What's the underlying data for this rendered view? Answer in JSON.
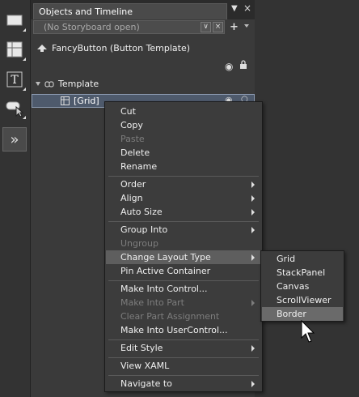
{
  "panel": {
    "tab_title": "Objects and Timeline",
    "pin_icon": "pin-icon",
    "close_icon": "close-icon",
    "storyboard": {
      "value": "(No Storyboard open)",
      "add_label": "+"
    },
    "scope_label": "FancyButton (Button Template)",
    "template_label": "Template",
    "grid_label": "[Grid]"
  },
  "toolbar": {
    "tools": [
      "rectangle-icon",
      "grid-layout-icon",
      "text-icon",
      "direct-selection-icon",
      "expand-assets-icon"
    ],
    "expand_label": "»"
  },
  "context_menu": {
    "items": [
      {
        "label": "Cut",
        "enabled": true
      },
      {
        "label": "Copy",
        "enabled": true
      },
      {
        "label": "Paste",
        "enabled": false
      },
      {
        "label": "Delete",
        "enabled": true
      },
      {
        "label": "Rename",
        "enabled": true
      },
      {
        "label": "Order",
        "enabled": true,
        "submenu": true
      },
      {
        "label": "Align",
        "enabled": true,
        "submenu": true
      },
      {
        "label": "Auto Size",
        "enabled": true,
        "submenu": true
      },
      {
        "label": "Group Into",
        "enabled": true,
        "submenu": true
      },
      {
        "label": "Ungroup",
        "enabled": false
      },
      {
        "label": "Change Layout Type",
        "enabled": true,
        "submenu": true,
        "highlighted": true
      },
      {
        "label": "Pin Active Container",
        "enabled": true
      },
      {
        "label": "Make Into Control...",
        "enabled": true
      },
      {
        "label": "Make Into Part",
        "enabled": false,
        "submenu": true
      },
      {
        "label": "Clear Part Assignment",
        "enabled": false
      },
      {
        "label": "Make Into UserControl...",
        "enabled": true
      },
      {
        "label": "Edit Style",
        "enabled": true,
        "submenu": true
      },
      {
        "label": "View XAML",
        "enabled": true
      },
      {
        "label": "Navigate to",
        "enabled": true,
        "submenu": true
      }
    ]
  },
  "layout_submenu": {
    "items": [
      {
        "label": "Grid"
      },
      {
        "label": "StackPanel"
      },
      {
        "label": "Canvas"
      },
      {
        "label": "ScrollViewer"
      },
      {
        "label": "Border",
        "highlighted": true
      }
    ]
  },
  "colors": {
    "background": "#333333",
    "panel": "#3a3a3a",
    "menu": "#3c3c3c",
    "highlight": "#5e5e5e",
    "selection": "#4e5a6c"
  }
}
